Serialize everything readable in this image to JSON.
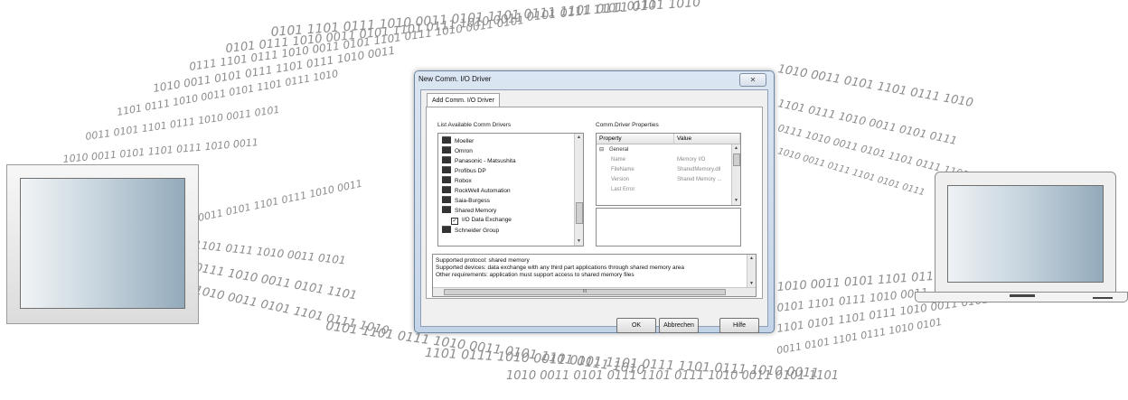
{
  "dialog": {
    "title": "New Comm. I/O Driver",
    "close_icon": "close-icon",
    "tab_label": "Add Comm. I/O Driver",
    "list_label": "List Available Comm Drivers",
    "props_label": "Comm.Driver Properties",
    "drivers": [
      {
        "label": "Moeller",
        "icon": "folder-icon"
      },
      {
        "label": "Omron",
        "icon": "folder-icon"
      },
      {
        "label": "Panasonic - Matsushita",
        "icon": "folder-icon"
      },
      {
        "label": "Profibus DP",
        "icon": "folder-icon"
      },
      {
        "label": "Robox",
        "icon": "folder-icon"
      },
      {
        "label": "RockWell Automation",
        "icon": "folder-icon"
      },
      {
        "label": "Saia-Burgess",
        "icon": "folder-icon"
      },
      {
        "label": "Shared Memory",
        "icon": "folder-icon"
      },
      {
        "label": "I/O Data Exchange",
        "icon": "checkbox-icon",
        "checked": true
      },
      {
        "label": "Schneider Group",
        "icon": "folder-icon"
      }
    ],
    "property_grid": {
      "headers": [
        "Property",
        "Value"
      ],
      "group": "General",
      "rows": [
        {
          "property": "Name",
          "value": "Memory I/O"
        },
        {
          "property": "FileName",
          "value": "SharedMemory.dll"
        },
        {
          "property": "Version",
          "value": "Shared Memory ..."
        },
        {
          "property": "Last Error",
          "value": ""
        }
      ]
    },
    "info_lines": [
      "Supported protocol: shared memory",
      "Supported devices: data exchange with any third part applications through shared memory area",
      "Other requirements: application must support access to shared memory files"
    ],
    "buttons": {
      "ok": "OK",
      "cancel": "Abbrechen",
      "help": "Hilfe"
    }
  },
  "devices": {
    "left": "monitor-icon",
    "right": "laptop-icon"
  }
}
